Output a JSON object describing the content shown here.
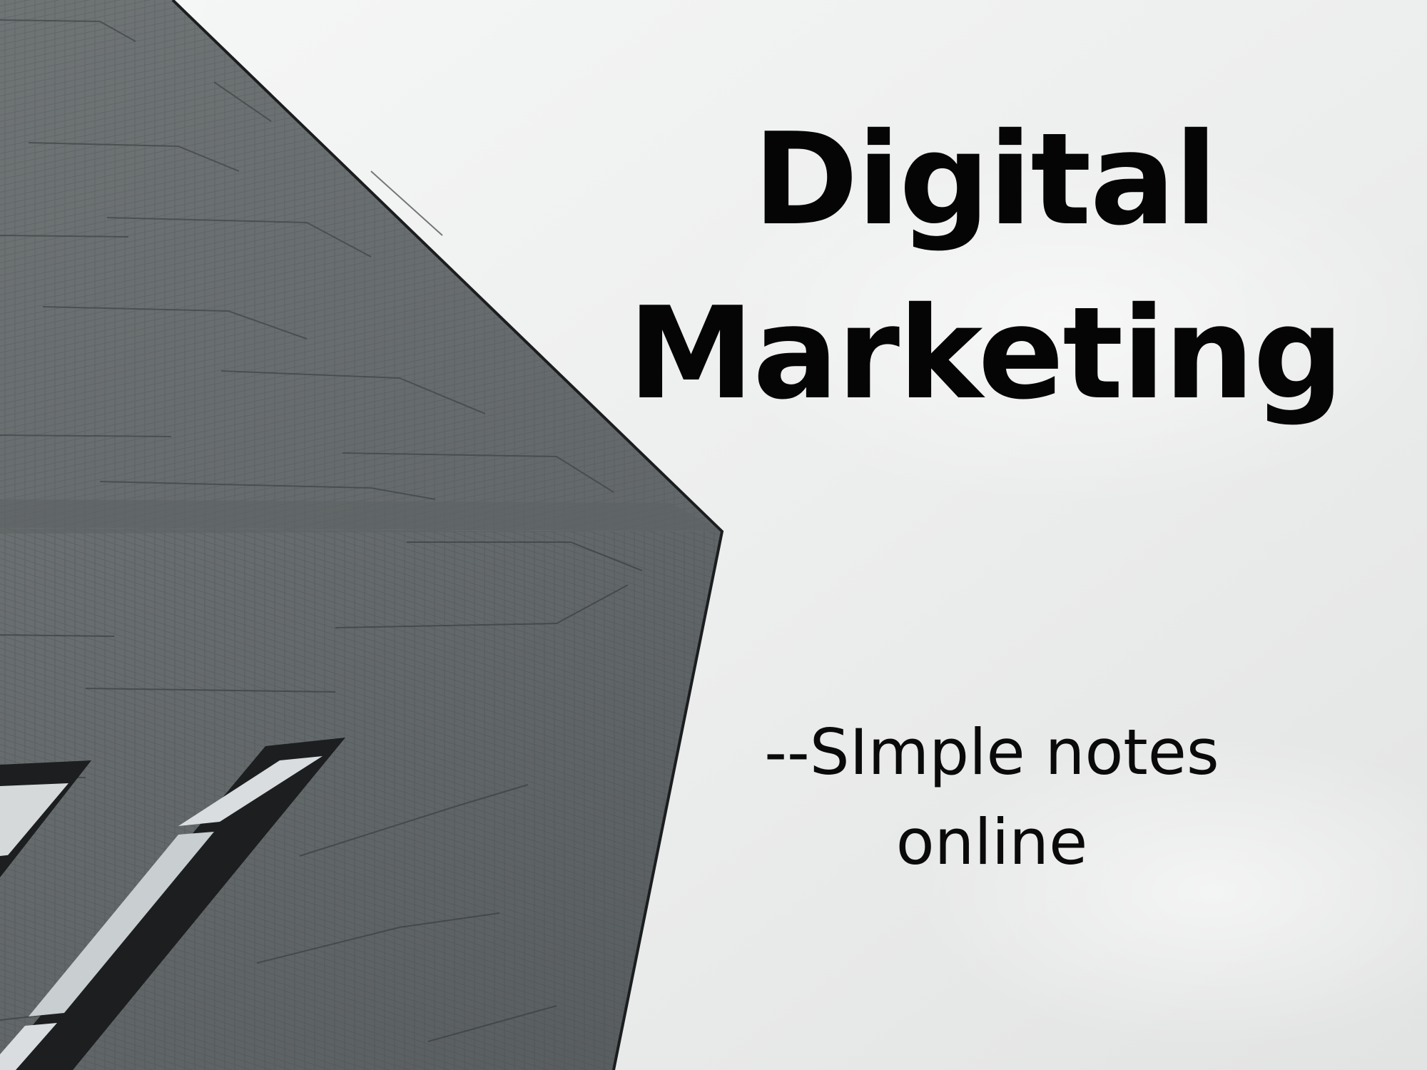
{
  "slide": {
    "title_lines": [
      "Digital",
      "Marketing"
    ],
    "subtitle_lines": [
      "--SImple notes",
      "online"
    ]
  },
  "colors": {
    "sky_light": "#f1f2f2",
    "sky_shadow": "#dcdddd",
    "building_panel": "#696e6f",
    "building_dark": "#4c5152",
    "building_edge": "#1b1d1e",
    "window_glass": "#d7dbdc",
    "text": "#050505"
  }
}
